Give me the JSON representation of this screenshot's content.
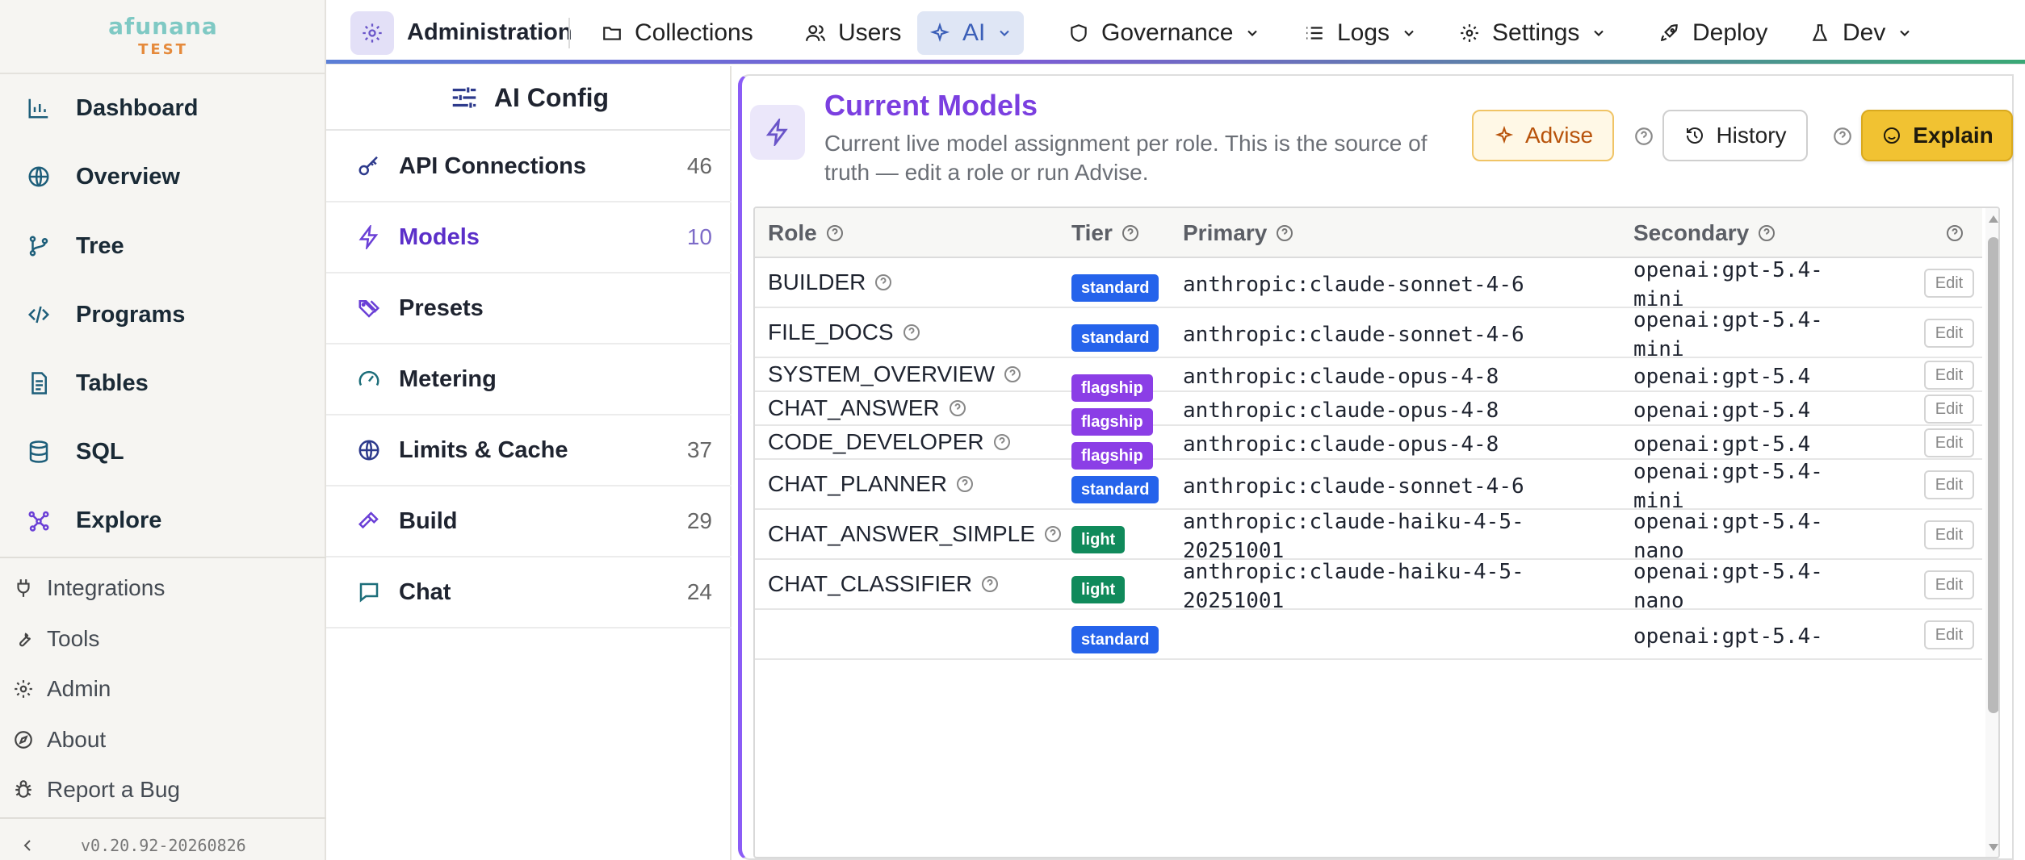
{
  "brand": {
    "name": "afunana",
    "env": "TEST"
  },
  "sidebar": {
    "nav": [
      {
        "label": "Dashboard",
        "icon": "bar-chart-icon"
      },
      {
        "label": "Overview",
        "icon": "globe-icon"
      },
      {
        "label": "Tree",
        "icon": "git-branch-icon"
      },
      {
        "label": "Programs",
        "icon": "code-icon"
      },
      {
        "label": "Tables",
        "icon": "file-text-icon"
      },
      {
        "label": "SQL",
        "icon": "database-icon"
      },
      {
        "label": "Explore",
        "icon": "explore-icon"
      }
    ],
    "secondary": [
      {
        "label": "Integrations",
        "icon": "plug-icon"
      },
      {
        "label": "Tools",
        "icon": "wrench-icon"
      },
      {
        "label": "Admin",
        "icon": "gear-icon"
      },
      {
        "label": "About",
        "icon": "compass-icon"
      },
      {
        "label": "Report a Bug",
        "icon": "bug-icon"
      }
    ],
    "version": "v0.20.92-20260826"
  },
  "topbar": {
    "section": "Administration",
    "tabs": [
      {
        "label": "Collections",
        "icon": "folder-icon",
        "dropdown": false
      },
      {
        "label": "Users",
        "icon": "users-icon",
        "dropdown": false
      },
      {
        "label": "AI",
        "icon": "sparkle-icon",
        "dropdown": true,
        "active": true
      },
      {
        "label": "Governance",
        "icon": "shield-icon",
        "dropdown": true
      },
      {
        "label": "Logs",
        "icon": "list-icon",
        "dropdown": true
      },
      {
        "label": "Settings",
        "icon": "gear-icon",
        "dropdown": true
      },
      {
        "label": "Deploy",
        "icon": "rocket-icon",
        "dropdown": false
      },
      {
        "label": "Dev",
        "icon": "flask-icon",
        "dropdown": true
      }
    ]
  },
  "config": {
    "title": "AI Config",
    "items": [
      {
        "label": "API Connections",
        "count": "46",
        "icon": "key-icon"
      },
      {
        "label": "Models",
        "count": "10",
        "icon": "bolt-icon",
        "active": true
      },
      {
        "label": "Presets",
        "count": "",
        "icon": "tags-icon"
      },
      {
        "label": "Metering",
        "count": "",
        "icon": "gauge-icon"
      },
      {
        "label": "Limits & Cache",
        "count": "37",
        "icon": "globe-icon"
      },
      {
        "label": "Build",
        "count": "29",
        "icon": "hammer-icon"
      },
      {
        "label": "Chat",
        "count": "24",
        "icon": "chat-icon"
      }
    ]
  },
  "card": {
    "title": "Current Models",
    "description": "Current live model assignment per role. This is the source of truth — edit a role or run Advise.",
    "buttons": {
      "advise": "Advise",
      "history": "History",
      "explain": "Explain"
    }
  },
  "table": {
    "headers": {
      "role": "Role",
      "tier": "Tier",
      "primary": "Primary",
      "secondary": "Secondary"
    },
    "edit_label": "Edit",
    "rows": [
      {
        "role": "BUILDER",
        "tier": "standard",
        "primary": [
          "anthropic:claude-sonnet-4-6"
        ],
        "secondary": [
          "openai:gpt-5.4-",
          "mini"
        ]
      },
      {
        "role": "FILE_DOCS",
        "tier": "standard",
        "primary": [
          "anthropic:claude-sonnet-4-6"
        ],
        "secondary": [
          "openai:gpt-5.4-",
          "mini"
        ]
      },
      {
        "role": "SYSTEM_OVERVIEW",
        "tier": "flagship",
        "primary": [
          "anthropic:claude-opus-4-8"
        ],
        "secondary": [
          "openai:gpt-5.4"
        ]
      },
      {
        "role": "CHAT_ANSWER",
        "tier": "flagship",
        "primary": [
          "anthropic:claude-opus-4-8"
        ],
        "secondary": [
          "openai:gpt-5.4"
        ]
      },
      {
        "role": "CODE_DEVELOPER",
        "tier": "flagship",
        "primary": [
          "anthropic:claude-opus-4-8"
        ],
        "secondary": [
          "openai:gpt-5.4"
        ]
      },
      {
        "role": "CHAT_PLANNER",
        "tier": "standard",
        "primary": [
          "anthropic:claude-sonnet-4-6"
        ],
        "secondary": [
          "openai:gpt-5.4-",
          "mini"
        ]
      },
      {
        "role": "CHAT_ANSWER_SIMPLE",
        "tier": "light",
        "primary": [
          "anthropic:claude-haiku-4-5-",
          "20251001"
        ],
        "secondary": [
          "openai:gpt-5.4-",
          "nano"
        ]
      },
      {
        "role": "CHAT_CLASSIFIER",
        "tier": "light",
        "primary": [
          "anthropic:claude-haiku-4-5-",
          "20251001"
        ],
        "secondary": [
          "openai:gpt-5.4-",
          "nano"
        ]
      },
      {
        "role": "",
        "tier": "standard",
        "primary": [
          ""
        ],
        "secondary": [
          "openai:gpt-5.4-"
        ]
      }
    ]
  },
  "colors": {
    "accent": "#8b5cf6",
    "title": "#7b3fe0",
    "standard": "#2563eb",
    "flagship": "#8b3ee6",
    "light": "#108a5b",
    "explain": "#f1c232"
  }
}
